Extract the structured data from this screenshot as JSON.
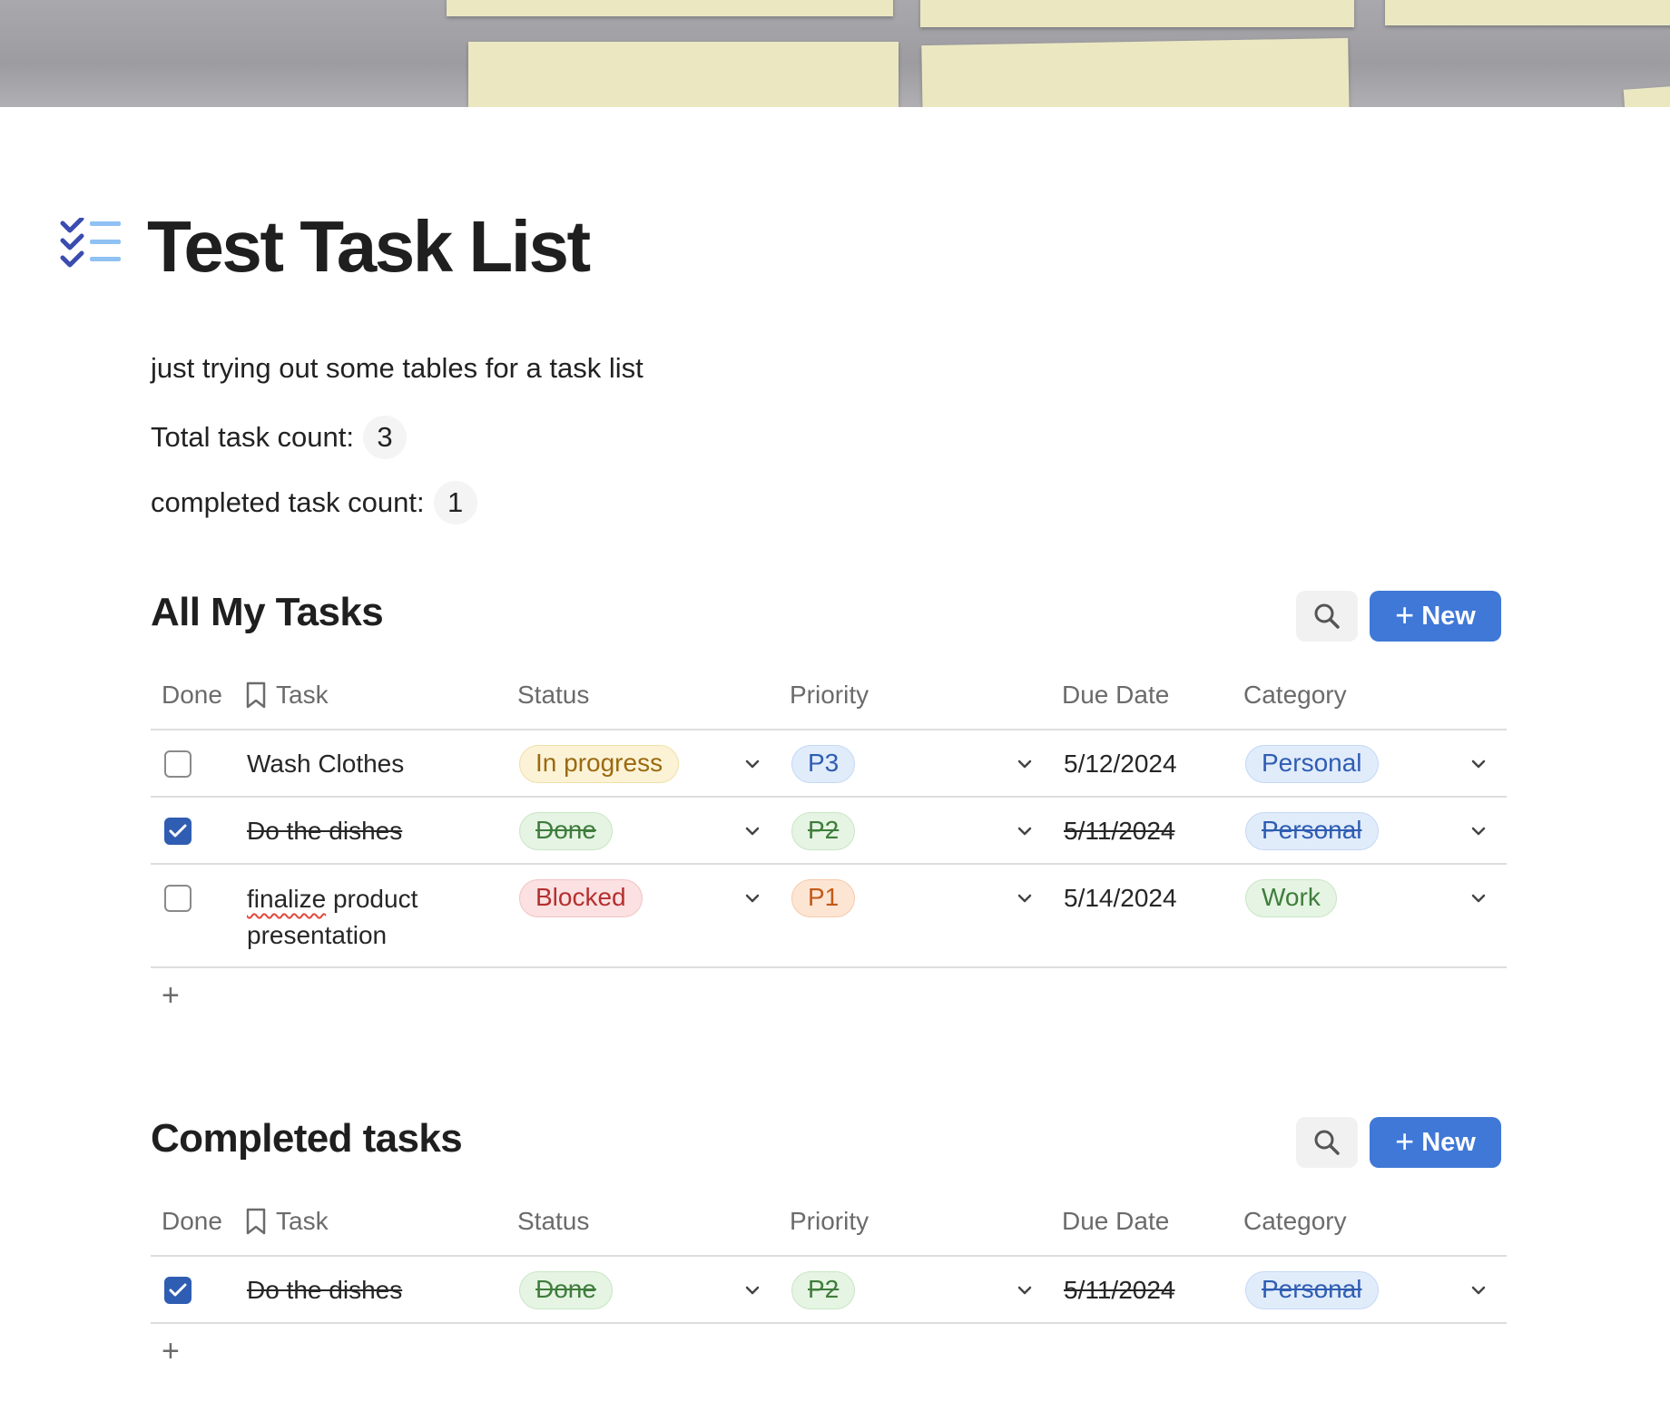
{
  "page": {
    "title": "Test Task List",
    "icon": "checklist-icon",
    "description": "just trying out some tables for a task list",
    "total_label": "Total task count:",
    "total_value": "3",
    "completed_label": "completed task count:",
    "completed_value": "1"
  },
  "colors": {
    "accent": "#3f78d6",
    "checkbox_checked": "#2f5db2",
    "status_in_progress_bg": "#fcf3d6",
    "status_in_progress_text": "#9a6a10",
    "status_done_bg": "#e5f4e3",
    "status_done_text": "#3f7d3c",
    "status_blocked_bg": "#fbe1e1",
    "status_blocked_text": "#b53030",
    "priority_p3_bg": "#e1ecfb",
    "priority_p3_text": "#2f5db2",
    "priority_p1_bg": "#fde5d4",
    "priority_p1_text": "#c25a18",
    "category_personal_bg": "#e1ecfb",
    "category_personal_text": "#2f5db2",
    "category_work_bg": "#e5f4e3",
    "category_work_text": "#3f7d3c"
  },
  "columns": {
    "done": "Done",
    "task": "Task",
    "status": "Status",
    "priority": "Priority",
    "due_date": "Due Date",
    "category": "Category"
  },
  "all_tasks": {
    "title": "All My Tasks",
    "new_label": "New",
    "rows": [
      {
        "done": false,
        "task": "Wash Clothes",
        "status": "In progress",
        "priority": "P3",
        "due": "5/12/2024",
        "category": "Personal"
      },
      {
        "done": true,
        "task": "Do the dishes",
        "status": "Done",
        "priority": "P2",
        "due": "5/11/2024",
        "category": "Personal"
      },
      {
        "done": false,
        "task_word1": "finalize",
        "task_rest": " product presentation",
        "status": "Blocked",
        "priority": "P1",
        "due": "5/14/2024",
        "category": "Work"
      }
    ],
    "add_label": "+"
  },
  "completed_tasks": {
    "title": "Completed tasks",
    "new_label": "New",
    "rows": [
      {
        "done": true,
        "task": "Do the dishes",
        "status": "Done",
        "priority": "P2",
        "due": "5/11/2024",
        "category": "Personal"
      }
    ],
    "add_label": "+"
  }
}
